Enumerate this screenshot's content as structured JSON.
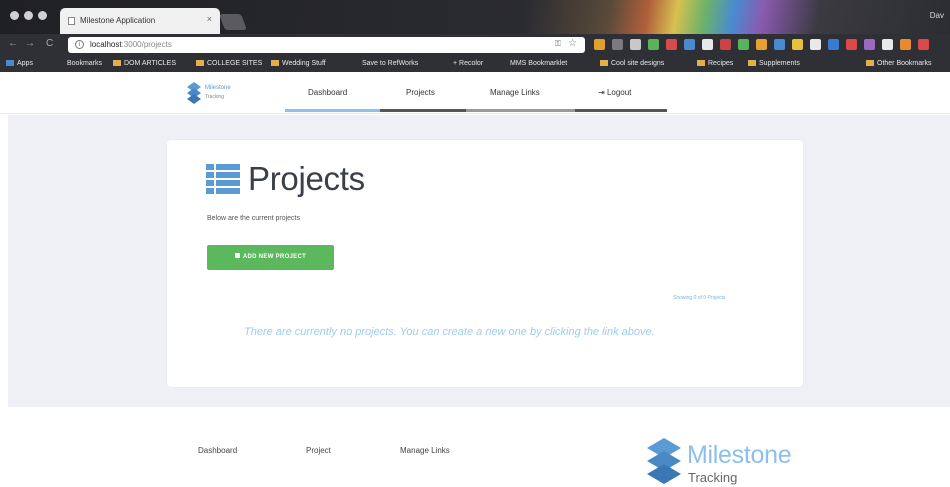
{
  "browser": {
    "tab_title": "Milestone Application",
    "tab_close": "×",
    "corner_label": "Dav",
    "url_host": "localhost",
    "url_path": ":3000/projects",
    "back": "←",
    "forward": "→",
    "reload": "C",
    "bookmarks": [
      "Apps",
      "Bookmarks",
      "DOM ARTICLES",
      "COLLEGE SITES",
      "Wedding Stuff",
      "Save to RefWorks",
      "+ Recolor",
      "MMS Bookmarklet",
      "Cool site designs",
      "Recipes",
      "Supplements",
      "Other Bookmarks"
    ],
    "extension_colors": [
      "#e0a030",
      "#7a7a80",
      "#c8c8c8",
      "#5ab35a",
      "#d94a4a",
      "#4a8ad0",
      "#e8e8e8",
      "#c94444",
      "#5ab35a",
      "#e8a030",
      "#4a8ad0",
      "#e8c040",
      "#e8e8e8",
      "#3a7ad0",
      "#d94a4a",
      "#9a6ac0",
      "#e8e8e8",
      "#e88a30",
      "#d94a4a"
    ]
  },
  "header": {
    "brand_name": "Milestone",
    "brand_sub": "Tracking",
    "nav": {
      "dashboard": "Dashboard",
      "projects": "Projects",
      "manage_links": "Manage Links",
      "logout": "Logout",
      "logout_icon": "⇥"
    }
  },
  "main": {
    "title": "Projects",
    "subtitle": "Below are the current projects",
    "add_button": "ADD NEW PROJECT",
    "show_link": "Showing 0 of 0 Projects",
    "empty_message": "There are currently no projects. You can create a new one by clicking the link above."
  },
  "footer": {
    "links": {
      "dashboard": "Dashboard",
      "project": "Project",
      "manage_links": "Manage Links"
    },
    "brand_name": "Milestone",
    "brand_sub": "Tracking"
  },
  "colors": {
    "accent_blue": "#5b9bd5",
    "button_green": "#5cb85c",
    "background_gray": "#eef0f5",
    "empty_text_blue": "#9ecbf0"
  }
}
